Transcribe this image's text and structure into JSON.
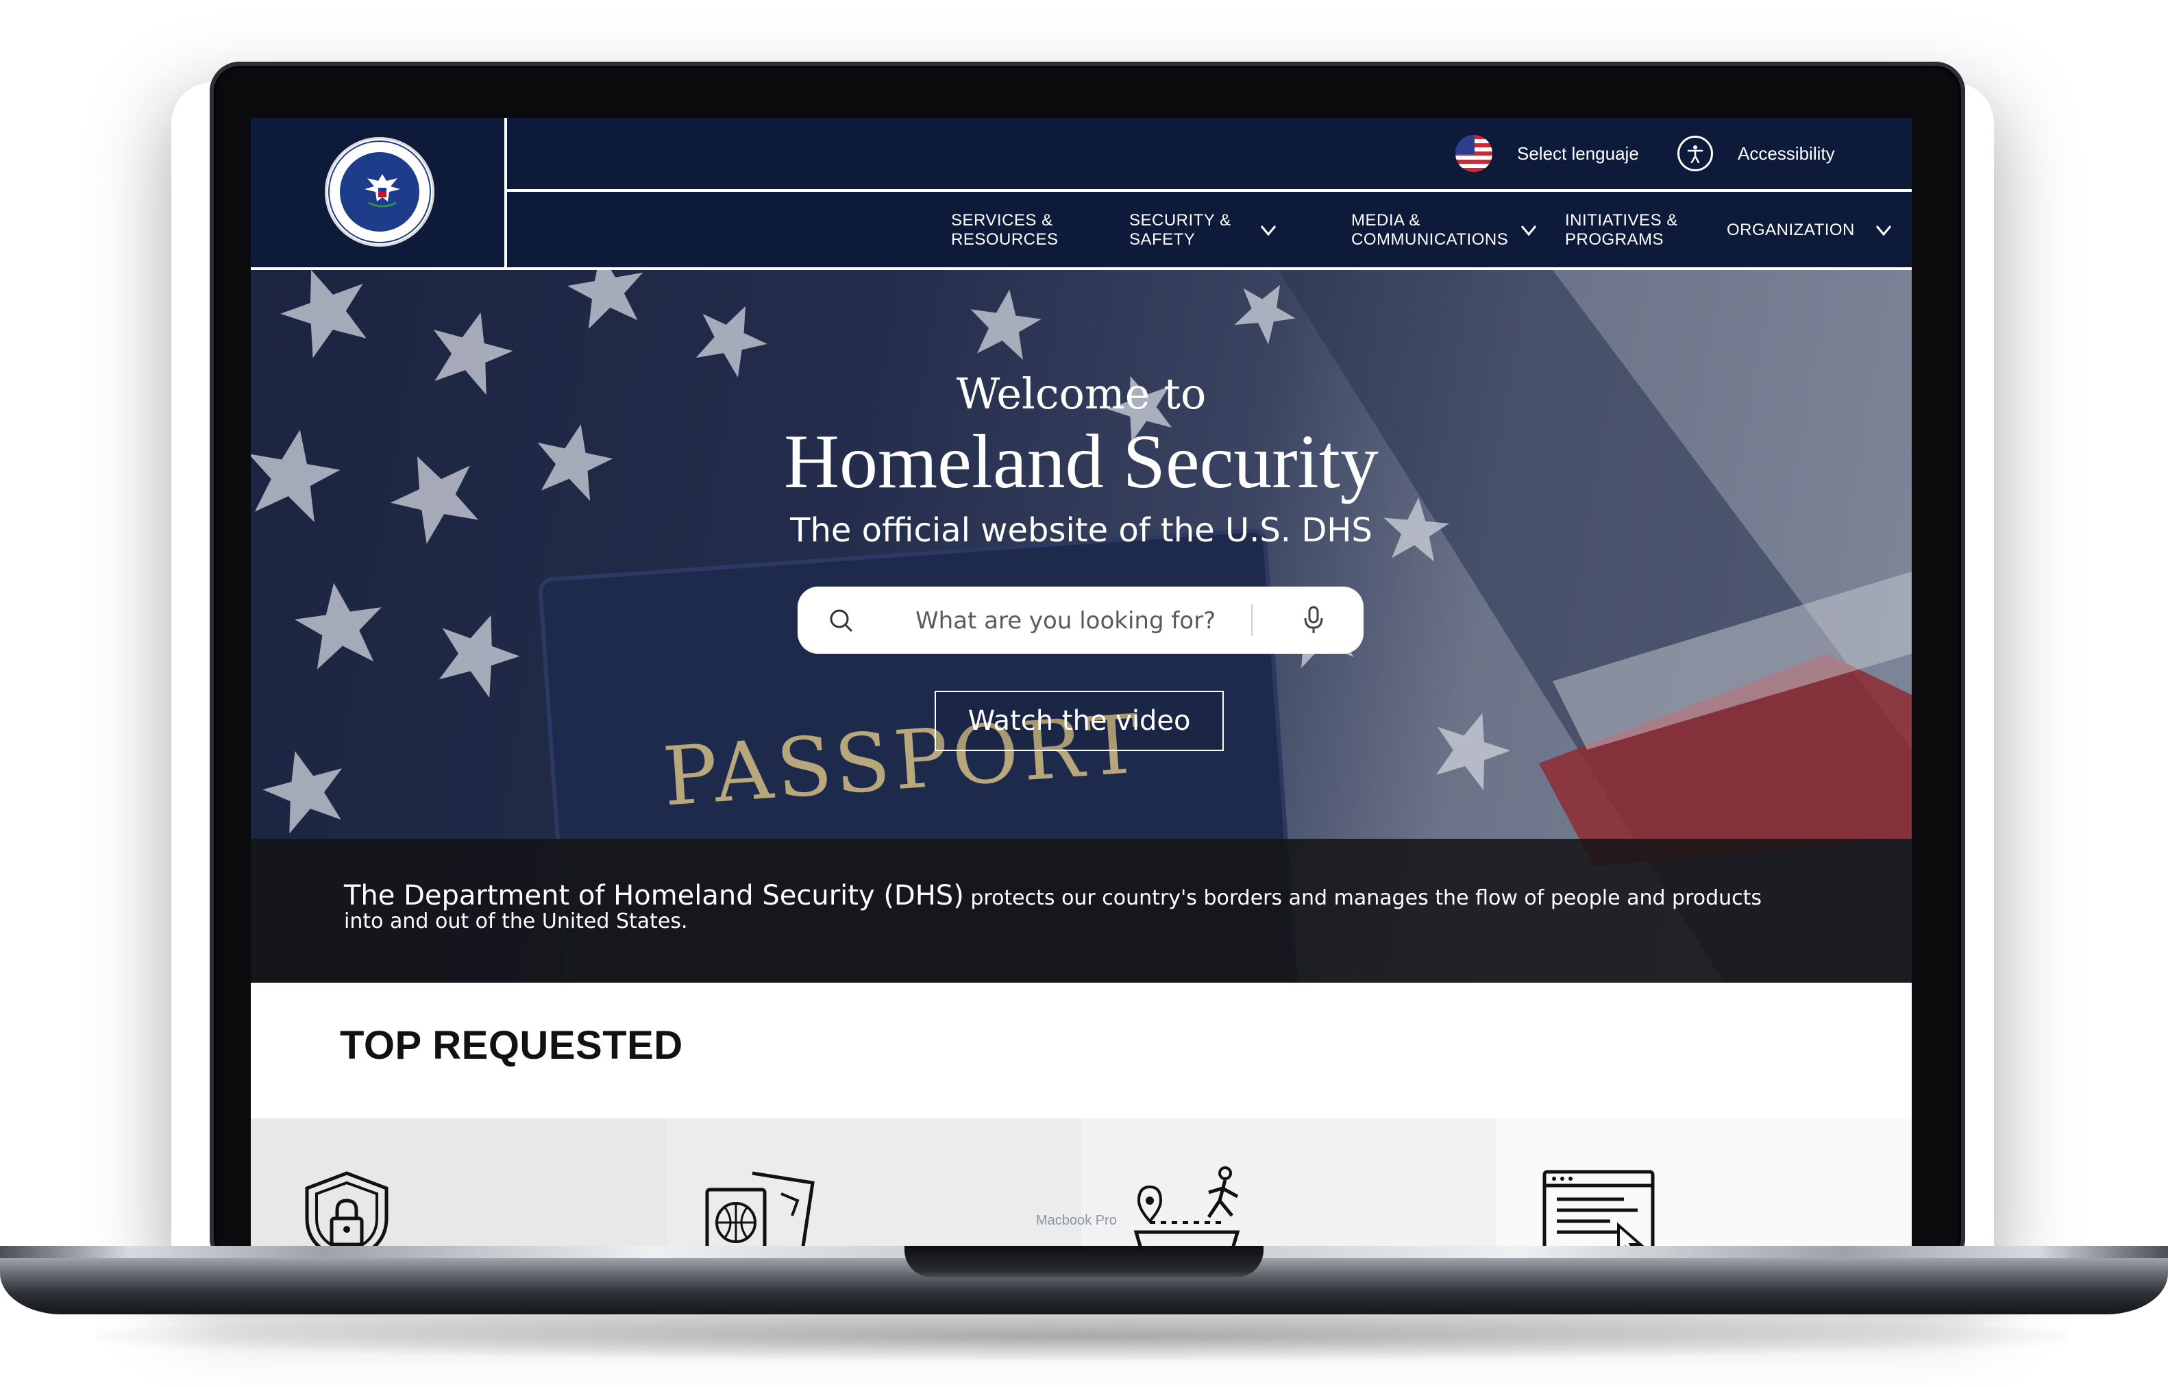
{
  "device": {
    "label": "Macbook Pro"
  },
  "header": {
    "logo_alt": "U.S. Department of Homeland Security seal",
    "language_label": "Select lenguaje",
    "accessibility_label": "Accessibility",
    "nav": [
      {
        "label": "SERVICES &\nRESOURCES",
        "has_dropdown": false
      },
      {
        "label": "SECURITY &\nSAFETY",
        "has_dropdown": true
      },
      {
        "label": "MEDIA &\nCOMMUNICATIONS",
        "has_dropdown": true
      },
      {
        "label": "INITIATIVES &\nPROGRAMS",
        "has_dropdown": false
      },
      {
        "label": "ORGANIZATION",
        "has_dropdown": true
      }
    ]
  },
  "hero": {
    "welcome": "Welcome to",
    "title": "Homeland Security",
    "subtitle": "The official website of the U.S. DHS",
    "search_placeholder": "What are you looking for?",
    "watch_button": "Watch the video",
    "background_text": "PASSPORT",
    "band_strong": "The Department of Homeland Security (DHS)",
    "band_text": " protects our country's borders and manages the flow of people and products into and out of the United States."
  },
  "top_requested": {
    "title": "TOP REQUESTED",
    "tiles": [
      {
        "icon": "shield-lock-icon",
        "bg": "#e8e8e8"
      },
      {
        "icon": "passport-globe-icon",
        "bg": "#ececec"
      },
      {
        "icon": "travel-route-icon",
        "bg": "#f2f2f2"
      },
      {
        "icon": "web-form-icon",
        "bg": "#fafafa"
      }
    ]
  },
  "colors": {
    "navy": "#0e1a3a",
    "white": "#ffffff",
    "band": "#141416"
  }
}
